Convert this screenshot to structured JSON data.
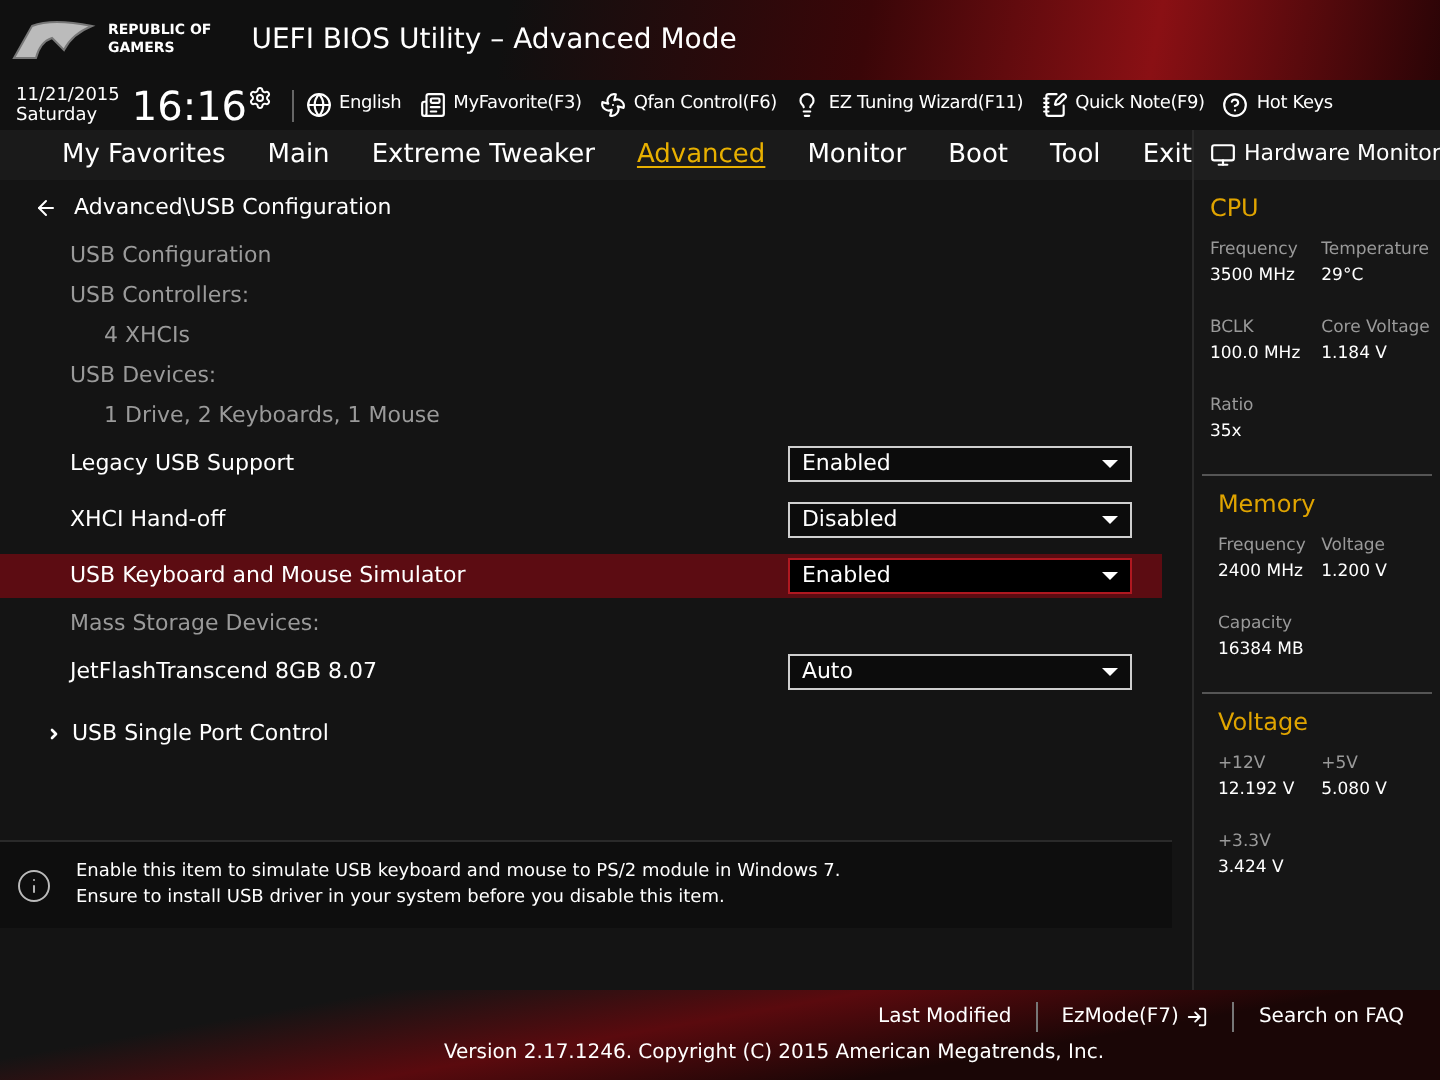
{
  "header": {
    "brand_line_1": "REPUBLIC OF",
    "brand_line_2": "GAMERS",
    "title": "UEFI BIOS Utility – Advanced Mode"
  },
  "toolbar": {
    "date": "11/21/2015",
    "day": "Saturday",
    "time": "16:16",
    "items": [
      {
        "label": "English"
      },
      {
        "label": "MyFavorite(F3)"
      },
      {
        "label": "Qfan Control(F6)"
      },
      {
        "label": "EZ Tuning Wizard(F11)"
      },
      {
        "label": "Quick Note(F9)"
      },
      {
        "label": "Hot Keys"
      }
    ]
  },
  "tabs": [
    {
      "label": "My Favorites",
      "selected": false
    },
    {
      "label": "Main",
      "selected": false
    },
    {
      "label": "Extreme Tweaker",
      "selected": false
    },
    {
      "label": "Advanced",
      "selected": true
    },
    {
      "label": "Monitor",
      "selected": false
    },
    {
      "label": "Boot",
      "selected": false
    },
    {
      "label": "Tool",
      "selected": false
    },
    {
      "label": "Exit",
      "selected": false
    }
  ],
  "breadcrumb": "Advanced\\USB Configuration",
  "items": [
    {
      "kind": "info",
      "label": "USB Configuration"
    },
    {
      "kind": "info",
      "label": "USB Controllers:",
      "children": [
        {
          "kind": "info",
          "label": "4 XHCIs"
        }
      ]
    },
    {
      "kind": "info",
      "label": "USB Devices:",
      "children": [
        {
          "kind": "info",
          "label": "1 Drive, 2 Keyboards, 1 Mouse"
        }
      ]
    },
    {
      "kind": "setting",
      "label": "Legacy USB Support",
      "value": "Enabled",
      "selected": false
    },
    {
      "kind": "setting",
      "label": "XHCI Hand-off",
      "value": "Disabled",
      "selected": false
    },
    {
      "kind": "setting",
      "label": "USB Keyboard and Mouse Simulator",
      "value": "Enabled",
      "selected": true
    },
    {
      "kind": "info",
      "label": "Mass Storage Devices:"
    },
    {
      "kind": "setting",
      "label": "JetFlashTranscend 8GB 8.07",
      "value": "Auto",
      "selected": false
    },
    {
      "kind": "submenu",
      "label": "USB Single Port Control"
    }
  ],
  "help": [
    "Enable this item to simulate USB keyboard and mouse to PS/2 module in Windows 7.",
    "Ensure to install USB driver in your system before you disable this item."
  ],
  "hardware_monitor": {
    "title": "Hardware Monitor",
    "sections": [
      {
        "title": "CPU",
        "stats": [
          {
            "label": "Frequency",
            "value": "3500 MHz"
          },
          {
            "label": "Temperature",
            "value": "29°C"
          },
          {
            "label": "BCLK",
            "value": "100.0 MHz"
          },
          {
            "label": "Core Voltage",
            "value": "1.184 V"
          },
          {
            "label": "Ratio",
            "value": "35x"
          }
        ]
      },
      {
        "title": "Memory",
        "stats": [
          {
            "label": "Frequency",
            "value": "2400 MHz"
          },
          {
            "label": "Voltage",
            "value": "1.200 V"
          },
          {
            "label": "Capacity",
            "value": "16384 MB"
          }
        ]
      },
      {
        "title": "Voltage",
        "stats": [
          {
            "label": "+12V",
            "value": "12.192 V"
          },
          {
            "label": "+5V",
            "value": "5.080 V"
          },
          {
            "label": "+3.3V",
            "value": "3.424 V"
          }
        ]
      }
    ]
  },
  "footer": {
    "links": [
      {
        "label": "Last Modified"
      },
      {
        "label": "EzMode(F7)"
      },
      {
        "label": "Search on FAQ"
      }
    ],
    "version": "Version 2.17.1246. Copyright (C) 2015 American Megatrends, Inc."
  }
}
